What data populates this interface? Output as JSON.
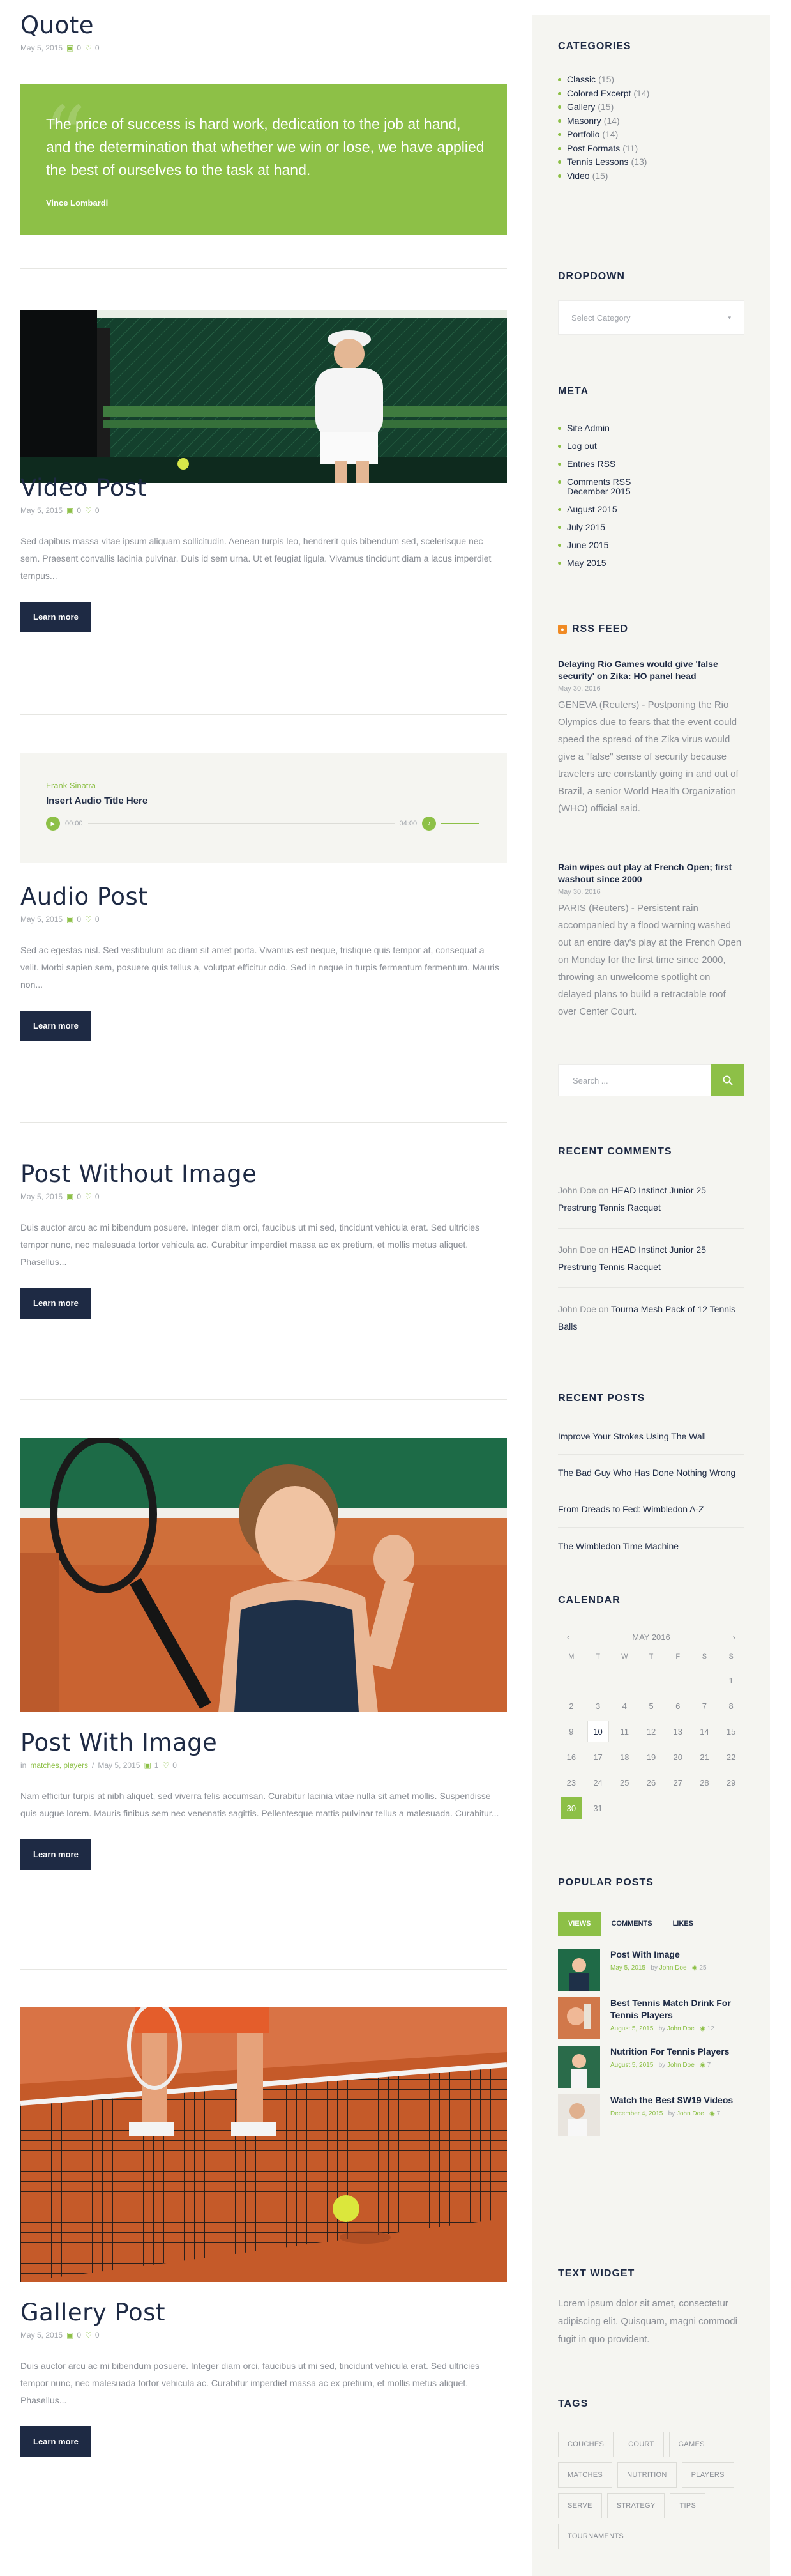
{
  "posts": {
    "quote": {
      "title": "Quote",
      "date": "May 5, 2015",
      "comments": "0",
      "likes": "0",
      "text": "The price of success is hard work, dedication to the job at hand, and the determination that whether we win or lose, we have applied the best of ourselves to the task at hand.",
      "author": "Vince Lombardi"
    },
    "video": {
      "title": "Video Post",
      "date": "May 5, 2015",
      "comments": "0",
      "likes": "0",
      "excerpt": "Sed dapibus massa vitae ipsum aliquam sollicitudin. Aenean turpis leo, hendrerit quis bibendum sed, scelerisque nec sem. Praesent convallis lacinia pulvinar. Duis id sem urna. Ut et feugiat ligula. Vivamus tincidunt diam a lacus imperdiet tempus...",
      "button": "Learn more"
    },
    "audio": {
      "artist": "Frank Sinatra",
      "track": "Insert Audio Title Here",
      "time_start": "00:00",
      "time_end": "04:00",
      "title": "Audio Post",
      "date": "May 5, 2015",
      "comments": "0",
      "likes": "0",
      "excerpt": "Sed ac egestas nisl. Sed vestibulum ac diam sit amet porta. Vivamus est neque, tristique quis tempor at, consequat a velit. Morbi sapien sem, posuere quis tellus a, volutpat efficitur odio. Sed in neque in turpis fermentum fermentum. Mauris non...",
      "button": "Learn more"
    },
    "noimage": {
      "title": "Post Without Image",
      "date": "May 5, 2015",
      "comments": "0",
      "likes": "0",
      "excerpt": "Duis auctor arcu ac mi bibendum posuere. Integer diam orci, faucibus ut mi sed, tincidunt vehicula erat. Sed ultricies tempor nunc, nec malesuada tortor vehicula ac. Curabitur imperdiet massa ac ex pretium, et mollis metus aliquet. Phasellus...",
      "button": "Learn more"
    },
    "withimage": {
      "title": "Post With Image",
      "category_prefix": "in",
      "categories": "matches, players",
      "date": "May 5, 2015",
      "comments": "1",
      "likes": "0",
      "excerpt": "Nam efficitur turpis at nibh aliquet, sed viverra felis accumsan. Curabitur lacinia vitae nulla sit amet mollis. Suspendisse quis augue lorem. Mauris finibus sem nec venenatis sagittis. Pellentesque mattis pulvinar tellus a malesuada. Curabitur...",
      "button": "Learn more"
    },
    "gallery": {
      "title": "Gallery Post",
      "date": "May 5, 2015",
      "comments": "0",
      "likes": "0",
      "excerpt": "Duis auctor arcu ac mi bibendum posuere. Integer diam orci, faucibus ut mi sed, tincidunt vehicula erat. Sed ultricies tempor nunc, nec malesuada tortor vehicula ac. Curabitur imperdiet massa ac ex pretium, et mollis metus aliquet. Phasellus...",
      "button": "Learn more"
    }
  },
  "sidebar": {
    "categories": {
      "title": "CATEGORIES",
      "items": [
        {
          "label": "Classic",
          "count": "(15)"
        },
        {
          "label": "Colored Excerpt",
          "count": "(14)"
        },
        {
          "label": "Gallery",
          "count": "(15)"
        },
        {
          "label": "Masonry",
          "count": "(14)"
        },
        {
          "label": "Portfolio",
          "count": "(14)"
        },
        {
          "label": "Post Formats",
          "count": "(11)"
        },
        {
          "label": "Tennis Lessons",
          "count": "(13)"
        },
        {
          "label": "Video",
          "count": "(15)"
        }
      ]
    },
    "dropdown": {
      "title": "DROPDOWN",
      "placeholder": "Select Category"
    },
    "meta": {
      "title": "META",
      "items": [
        "Site Admin",
        "Log out",
        "Entries RSS",
        "Comments RSS",
        "December 2015",
        "August 2015",
        "July 2015",
        "June 2015",
        "May 2015"
      ]
    },
    "rss": {
      "title": "RSS FEED",
      "items": [
        {
          "title": "Delaying Rio Games would give 'false security' on Zika: HO panel head",
          "date": "May 30, 2016",
          "text": "GENEVA (Reuters) - Postponing the Rio Olympics due to fears that the event could speed the spread of the Zika virus would give a \"false\" sense of security because travelers are constantly going in and out of Brazil, a senior World Health Organization (WHO) official said."
        },
        {
          "title": "Rain wipes out play at French Open; first washout since 2000",
          "date": "May 30, 2016",
          "text": "PARIS (Reuters) - Persistent rain accompanied by a flood warning washed out an entire day's play at the French Open on Monday for the first time since 2000, throwing an unwelcome spotlight on delayed plans to build a retractable roof over Center Court."
        }
      ]
    },
    "search": {
      "placeholder": "Search ..."
    },
    "recent_comments": {
      "title": "RECENT COMMENTS",
      "items": [
        {
          "author": "John Doe",
          "on": "on",
          "post": "HEAD Instinct Junior 25 Prestrung Tennis Racquet"
        },
        {
          "author": "John Doe",
          "on": "on",
          "post": "HEAD Instinct Junior 25 Prestrung Tennis Racquet"
        },
        {
          "author": "John Doe",
          "on": "on",
          "post": "Tourna Mesh Pack of 12 Tennis Balls"
        }
      ]
    },
    "recent_posts": {
      "title": "RECENT POSTS",
      "items": [
        "Improve Your Strokes Using The Wall",
        "The Bad Guy Who Has Done Nothing Wrong",
        "From Dreads to Fed: Wimbledon A-Z",
        "The Wimbledon Time Machine"
      ]
    },
    "calendar": {
      "title": "CALENDAR",
      "month": "MAY 2016",
      "prev": "‹",
      "next": "›",
      "weekdays": [
        "M",
        "T",
        "W",
        "T",
        "F",
        "S",
        "S"
      ],
      "weeks": [
        [
          "",
          "",
          "",
          "",
          "",
          "",
          "1"
        ],
        [
          "2",
          "3",
          "4",
          "5",
          "6",
          "7",
          "8"
        ],
        [
          "9",
          "10",
          "11",
          "12",
          "13",
          "14",
          "15"
        ],
        [
          "16",
          "17",
          "18",
          "19",
          "20",
          "21",
          "22"
        ],
        [
          "23",
          "24",
          "25",
          "26",
          "27",
          "28",
          "29"
        ],
        [
          "30",
          "31",
          "",
          "",
          "",
          "",
          ""
        ]
      ]
    },
    "popular": {
      "title": "POPULAR POSTS",
      "tabs": [
        "VIEWS",
        "COMMENTS",
        "LIKES"
      ],
      "items": [
        {
          "title": "Post With Image",
          "date": "May 5, 2015",
          "by": "by",
          "author": "John Doe",
          "views": "25"
        },
        {
          "title": "Best Tennis Match Drink For Tennis Players",
          "date": "August 5, 2015",
          "by": "by",
          "author": "John Doe",
          "views": "12"
        },
        {
          "title": "Nutrition For Tennis Players",
          "date": "August 5, 2015",
          "by": "by",
          "author": "John Doe",
          "views": "7"
        },
        {
          "title": "Watch the Best SW19 Videos",
          "date": "December 4, 2015",
          "by": "by",
          "author": "John Doe",
          "views": "7"
        }
      ]
    },
    "text_widget": {
      "title": "TEXT WIDGET",
      "text": "Lorem ipsum dolor sit amet, consectetur adipiscing elit. Quisquam, magni commodi fugit in quo provident."
    },
    "tags": {
      "title": "TAGS",
      "items": [
        "COUCHES",
        "COURT",
        "GAMES",
        "MATCHES",
        "NUTRITION",
        "PLAYERS",
        "SERVE",
        "STRATEGY",
        "TIPS",
        "TOURNAMENTS"
      ]
    }
  },
  "colors": {
    "accent": "#8dc047",
    "navy": "#1e2a44",
    "sidebar_bg": "#f5f5f1"
  }
}
